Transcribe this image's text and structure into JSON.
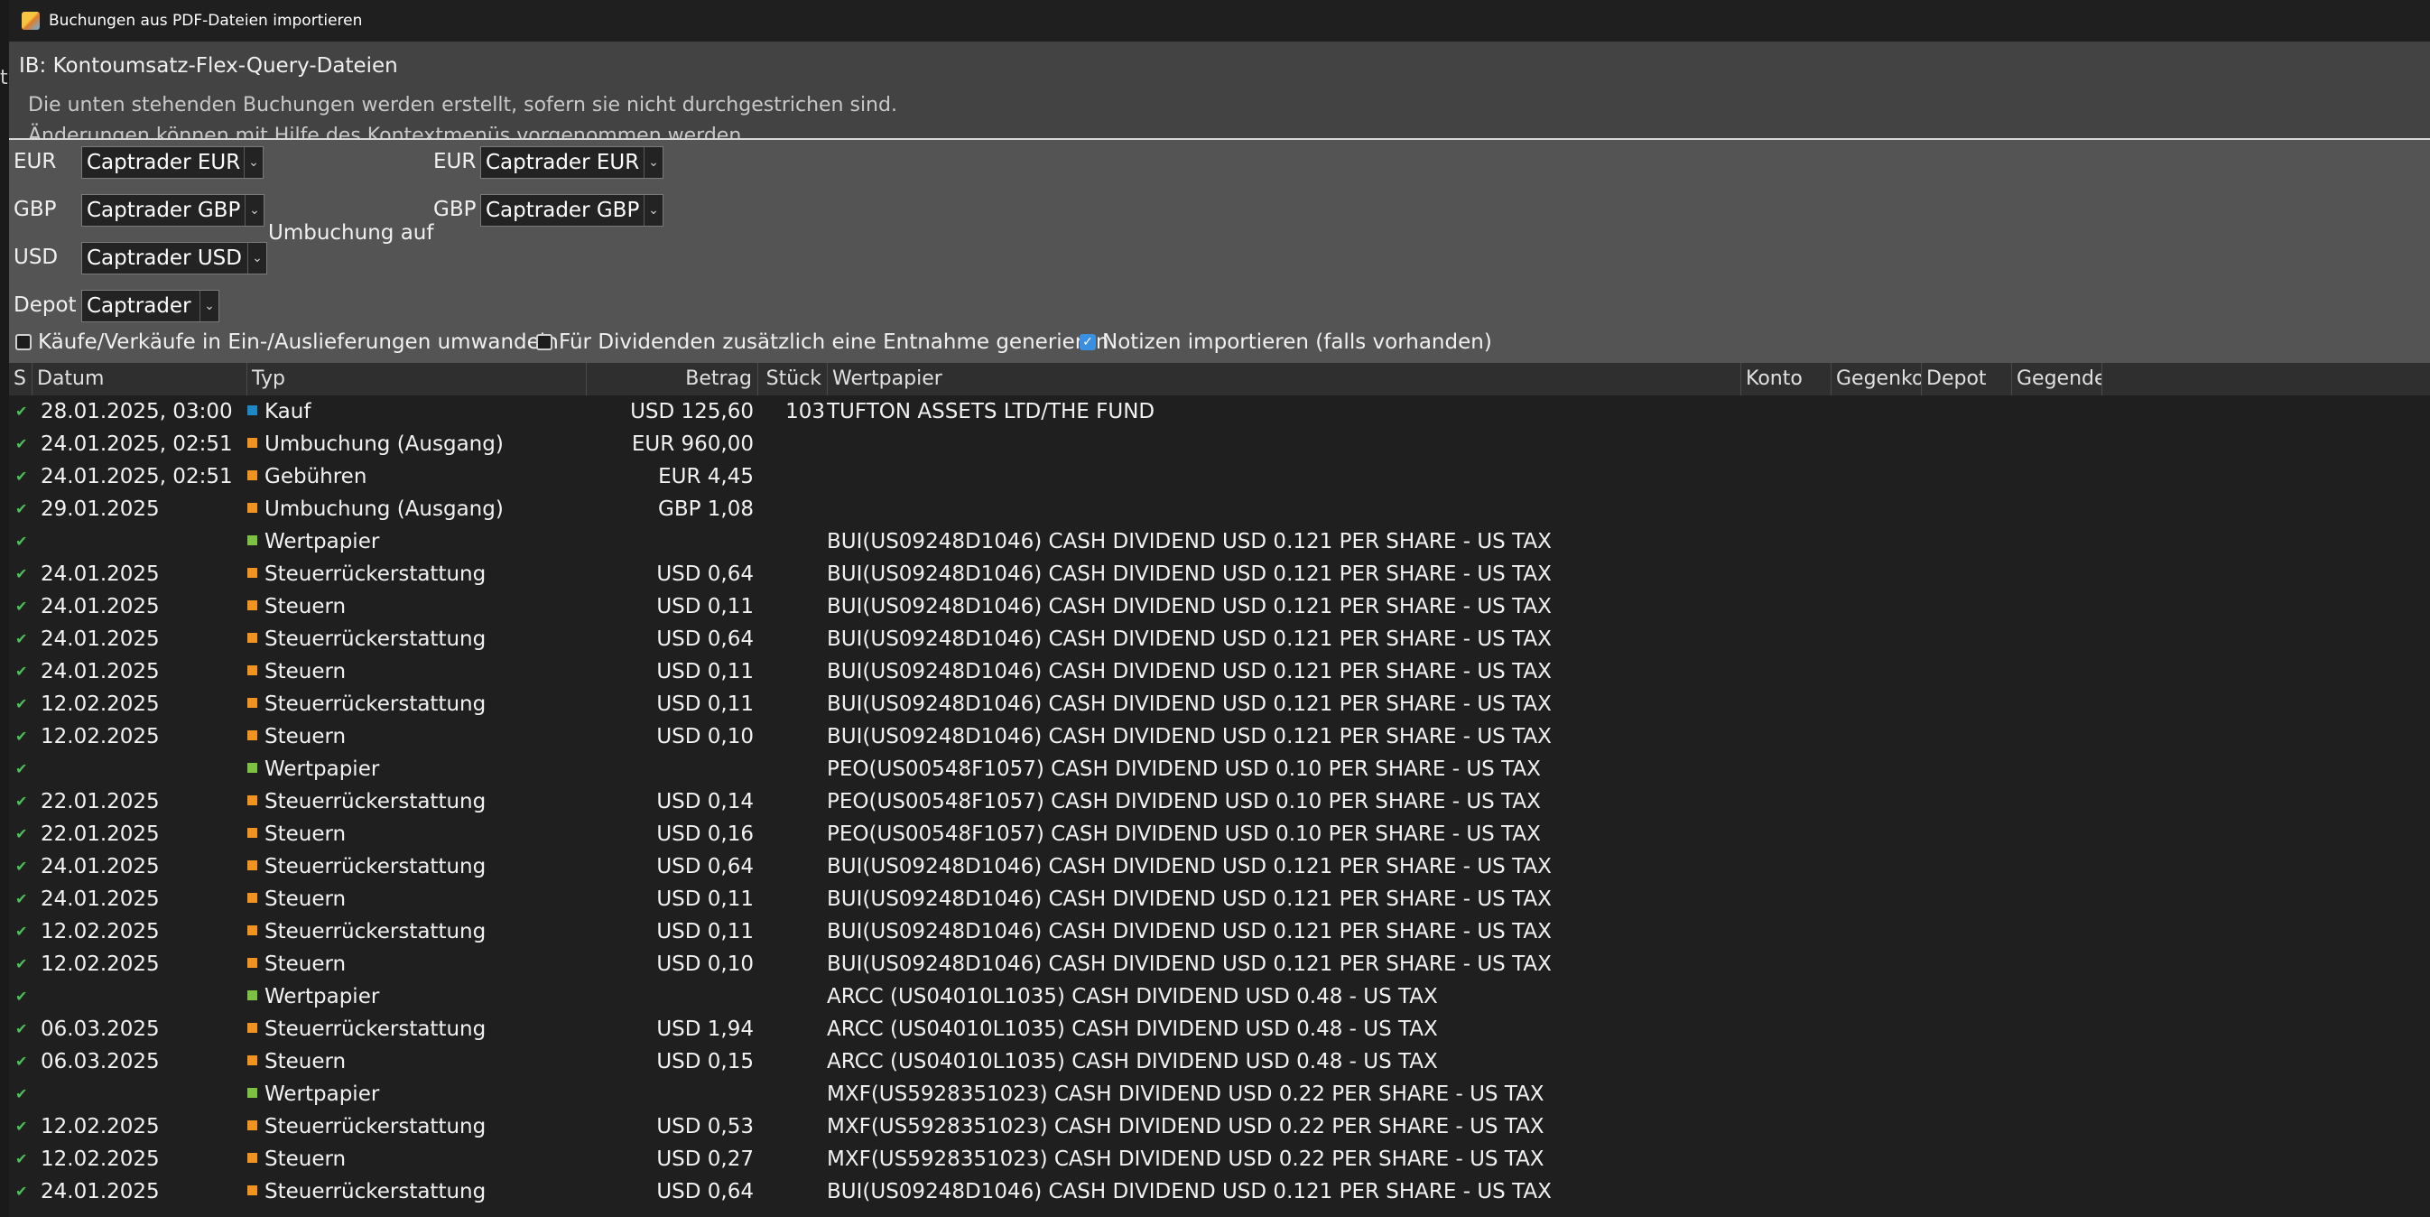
{
  "window": {
    "title": "Buchungen aus PDF-Dateien importieren"
  },
  "header": {
    "heading": "IB: Kontoumsatz-Flex-Query-Dateien",
    "line1": "Die unten stehenden Buchungen werden erstellt, sofern sie nicht durchgestrichen sind.",
    "line2": "Änderungen können mit Hilfe des Kontextmenüs vorgenommen werden."
  },
  "accounts": {
    "left": [
      {
        "currency": "EUR",
        "account": "Captrader EUR"
      },
      {
        "currency": "GBP",
        "account": "Captrader GBP"
      },
      {
        "currency": "USD",
        "account": "Captrader USD"
      }
    ],
    "transfer_label": "Umbuchung auf",
    "right": [
      {
        "currency": "EUR",
        "account": "Captrader EUR"
      },
      {
        "currency": "GBP",
        "account": "Captrader GBP"
      }
    ],
    "depot_label": "Depot",
    "depot_value": "Captrader"
  },
  "options": [
    {
      "label": "Käufe/Verkäufe in Ein-/Auslieferungen umwandeln",
      "checked": false
    },
    {
      "label": "Für Dividenden zusätzlich eine Entnahme generieren",
      "checked": false
    },
    {
      "label": "Notizen importieren (falls vorhanden)",
      "checked": true
    }
  ],
  "table": {
    "columns": [
      "S",
      "Datum",
      "Typ",
      "Betrag",
      "Stück",
      "Wertpapier",
      "Konto",
      "Gegenko",
      "Depot",
      "Gegende"
    ],
    "status_icon": "check-icon",
    "type_colors": {
      "orange": "#f0941f",
      "blue": "#1e88c7",
      "green": "#7cc142"
    },
    "rows": [
      {
        "date": "28.01.2025, 03:00",
        "type": "Kauf",
        "color": "blue",
        "amount": "USD 125,60",
        "qty": "103",
        "security": "TUFTON ASSETS LTD/THE FUND"
      },
      {
        "date": "24.01.2025, 02:51",
        "type": "Umbuchung (Ausgang)",
        "color": "orange",
        "amount": "EUR 960,00",
        "qty": "",
        "security": ""
      },
      {
        "date": "24.01.2025, 02:51",
        "type": "Gebühren",
        "color": "orange",
        "amount": "EUR 4,45",
        "qty": "",
        "security": ""
      },
      {
        "date": "29.01.2025",
        "type": "Umbuchung (Ausgang)",
        "color": "orange",
        "amount": "GBP 1,08",
        "qty": "",
        "security": ""
      },
      {
        "date": "",
        "type": "Wertpapier",
        "color": "green",
        "amount": "",
        "qty": "",
        "security": "BUI(US09248D1046) CASH DIVIDEND USD 0.121 PER SHARE - US TAX"
      },
      {
        "date": "24.01.2025",
        "type": "Steuerrückerstattung",
        "color": "orange",
        "amount": "USD 0,64",
        "qty": "",
        "security": "BUI(US09248D1046) CASH DIVIDEND USD 0.121 PER SHARE - US TAX"
      },
      {
        "date": "24.01.2025",
        "type": "Steuern",
        "color": "orange",
        "amount": "USD 0,11",
        "qty": "",
        "security": "BUI(US09248D1046) CASH DIVIDEND USD 0.121 PER SHARE - US TAX"
      },
      {
        "date": "24.01.2025",
        "type": "Steuerrückerstattung",
        "color": "orange",
        "amount": "USD 0,64",
        "qty": "",
        "security": "BUI(US09248D1046) CASH DIVIDEND USD 0.121 PER SHARE - US TAX"
      },
      {
        "date": "24.01.2025",
        "type": "Steuern",
        "color": "orange",
        "amount": "USD 0,11",
        "qty": "",
        "security": "BUI(US09248D1046) CASH DIVIDEND USD 0.121 PER SHARE - US TAX"
      },
      {
        "date": "12.02.2025",
        "type": "Steuerrückerstattung",
        "color": "orange",
        "amount": "USD 0,11",
        "qty": "",
        "security": "BUI(US09248D1046) CASH DIVIDEND USD 0.121 PER SHARE - US TAX"
      },
      {
        "date": "12.02.2025",
        "type": "Steuern",
        "color": "orange",
        "amount": "USD 0,10",
        "qty": "",
        "security": "BUI(US09248D1046) CASH DIVIDEND USD 0.121 PER SHARE - US TAX"
      },
      {
        "date": "",
        "type": "Wertpapier",
        "color": "green",
        "amount": "",
        "qty": "",
        "security": "PEO(US00548F1057) CASH DIVIDEND USD 0.10 PER SHARE - US TAX"
      },
      {
        "date": "22.01.2025",
        "type": "Steuerrückerstattung",
        "color": "orange",
        "amount": "USD 0,14",
        "qty": "",
        "security": "PEO(US00548F1057) CASH DIVIDEND USD 0.10 PER SHARE - US TAX"
      },
      {
        "date": "22.01.2025",
        "type": "Steuern",
        "color": "orange",
        "amount": "USD 0,16",
        "qty": "",
        "security": "PEO(US00548F1057) CASH DIVIDEND USD 0.10 PER SHARE - US TAX"
      },
      {
        "date": "24.01.2025",
        "type": "Steuerrückerstattung",
        "color": "orange",
        "amount": "USD 0,64",
        "qty": "",
        "security": "BUI(US09248D1046) CASH DIVIDEND USD 0.121 PER SHARE - US TAX"
      },
      {
        "date": "24.01.2025",
        "type": "Steuern",
        "color": "orange",
        "amount": "USD 0,11",
        "qty": "",
        "security": "BUI(US09248D1046) CASH DIVIDEND USD 0.121 PER SHARE - US TAX"
      },
      {
        "date": "12.02.2025",
        "type": "Steuerrückerstattung",
        "color": "orange",
        "amount": "USD 0,11",
        "qty": "",
        "security": "BUI(US09248D1046) CASH DIVIDEND USD 0.121 PER SHARE - US TAX"
      },
      {
        "date": "12.02.2025",
        "type": "Steuern",
        "color": "orange",
        "amount": "USD 0,10",
        "qty": "",
        "security": "BUI(US09248D1046) CASH DIVIDEND USD 0.121 PER SHARE - US TAX"
      },
      {
        "date": "",
        "type": "Wertpapier",
        "color": "green",
        "amount": "",
        "qty": "",
        "security": "ARCC (US04010L1035) CASH DIVIDEND USD 0.48 - US TAX"
      },
      {
        "date": "06.03.2025",
        "type": "Steuerrückerstattung",
        "color": "orange",
        "amount": "USD 1,94",
        "qty": "",
        "security": "ARCC (US04010L1035) CASH DIVIDEND USD 0.48 - US TAX"
      },
      {
        "date": "06.03.2025",
        "type": "Steuern",
        "color": "orange",
        "amount": "USD 0,15",
        "qty": "",
        "security": "ARCC (US04010L1035) CASH DIVIDEND USD 0.48 - US TAX"
      },
      {
        "date": "",
        "type": "Wertpapier",
        "color": "green",
        "amount": "",
        "qty": "",
        "security": "MXF(US5928351023) CASH DIVIDEND USD 0.22 PER SHARE - US TAX"
      },
      {
        "date": "12.02.2025",
        "type": "Steuerrückerstattung",
        "color": "orange",
        "amount": "USD 0,53",
        "qty": "",
        "security": "MXF(US5928351023) CASH DIVIDEND USD 0.22 PER SHARE - US TAX"
      },
      {
        "date": "12.02.2025",
        "type": "Steuern",
        "color": "orange",
        "amount": "USD 0,27",
        "qty": "",
        "security": "MXF(US5928351023) CASH DIVIDEND USD 0.22 PER SHARE - US TAX"
      },
      {
        "date": "24.01.2025",
        "type": "Steuerrückerstattung",
        "color": "orange",
        "amount": "USD 0,64",
        "qty": "",
        "security": "BUI(US09248D1046) CASH DIVIDEND USD 0.121 PER SHARE - US TAX"
      }
    ]
  }
}
